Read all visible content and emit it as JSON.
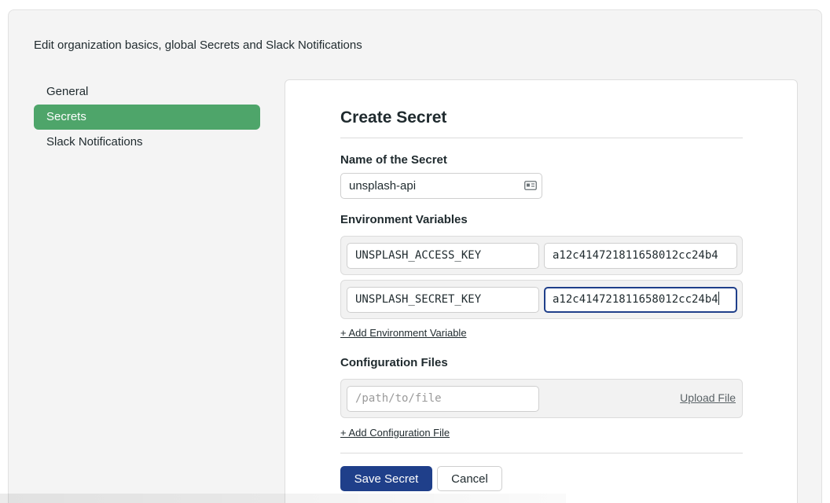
{
  "page": {
    "description": "Edit organization basics, global Secrets and Slack Notifications"
  },
  "sidebar": {
    "items": [
      {
        "label": "General",
        "active": false
      },
      {
        "label": "Secrets",
        "active": true
      },
      {
        "label": "Slack Notifications",
        "active": false
      }
    ]
  },
  "form": {
    "title": "Create Secret",
    "name_label": "Name of the Secret",
    "name_value": "unsplash-api",
    "env_label": "Environment Variables",
    "env_vars": [
      {
        "key": "UNSPLASH_ACCESS_KEY",
        "value": "a12c414721811658012cc24b4"
      },
      {
        "key": "UNSPLASH_SECRET_KEY",
        "value": "a12c414721811658012cc24b4"
      }
    ],
    "add_env_link": "+ Add Environment Variable",
    "config_label": "Configuration Files",
    "config_path_placeholder": "/path/to/file",
    "upload_label": "Upload File",
    "add_config_link": "+ Add Configuration File",
    "save_label": "Save Secret",
    "cancel_label": "Cancel"
  },
  "colors": {
    "active_nav": "#4ea56a",
    "primary_button": "#1f3f8a",
    "focus_border": "#1f3f8a"
  },
  "icons": {
    "name_input_icon": "id-card-icon"
  }
}
